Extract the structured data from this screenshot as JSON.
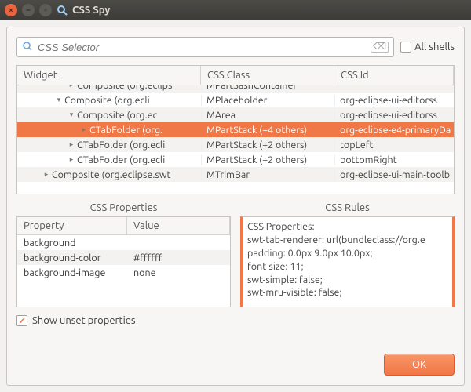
{
  "window": {
    "title": "CSS Spy"
  },
  "search": {
    "placeholder": "CSS Selector",
    "all_shells_label": "All shells"
  },
  "tree": {
    "headers": {
      "widget": "Widget",
      "css_class": "CSS Class",
      "css_id": "CSS Id"
    },
    "rows": [
      {
        "indent": 4,
        "twisty": "▸",
        "widget": "Composite (org.eclips",
        "cls": "MPartSashContainer",
        "id": "",
        "alt": true
      },
      {
        "indent": 3,
        "twisty": "▾",
        "widget": "Composite (org.ecli",
        "cls": "MPlaceholder",
        "id": "org-eclipse-ui-editorss",
        "alt": false
      },
      {
        "indent": 4,
        "twisty": "▾",
        "widget": "Composite (org.ec",
        "cls": "MArea",
        "id": "org-eclipse-ui-editorss",
        "alt": true
      },
      {
        "indent": 5,
        "twisty": "▸",
        "widget": "CTabFolder (org.",
        "cls": "MPartStack (+4 others)",
        "id": "org-eclipse-e4-primaryDa",
        "alt": false,
        "selected": true
      },
      {
        "indent": 4,
        "twisty": "▸",
        "widget": "CTabFolder (org.ecli",
        "cls": "MPartStack (+2 others)",
        "id": "topLeft",
        "alt": true
      },
      {
        "indent": 4,
        "twisty": "▸",
        "widget": "CTabFolder (org.ecli",
        "cls": "MPartStack (+2 others)",
        "id": "bottomRight",
        "alt": false
      },
      {
        "indent": 2,
        "twisty": "▸",
        "widget": "Composite (org.eclipse.swt",
        "cls": "MTrimBar",
        "id": "org-eclipse-ui-main-toolb",
        "alt": true
      }
    ]
  },
  "props_panel": {
    "title": "CSS Properties",
    "headers": {
      "property": "Property",
      "value": "Value"
    },
    "rows": [
      {
        "prop": "background",
        "val": "",
        "alt": false
      },
      {
        "prop": "background-color",
        "val": "#ffffff",
        "alt": true
      },
      {
        "prop": "background-image",
        "val": "none",
        "alt": false
      }
    ]
  },
  "rules_panel": {
    "title": "CSS Rules",
    "lines": [
      "CSS Properties:",
      "swt-tab-renderer: url(bundleclass://org.e",
      "padding: 0.0px 9.0px 10.0px;",
      "font-size: 11;",
      "swt-simple: false;",
      "swt-mru-visible: false;"
    ]
  },
  "show_unset_label": "Show unset properties",
  "ok_label": "OK"
}
